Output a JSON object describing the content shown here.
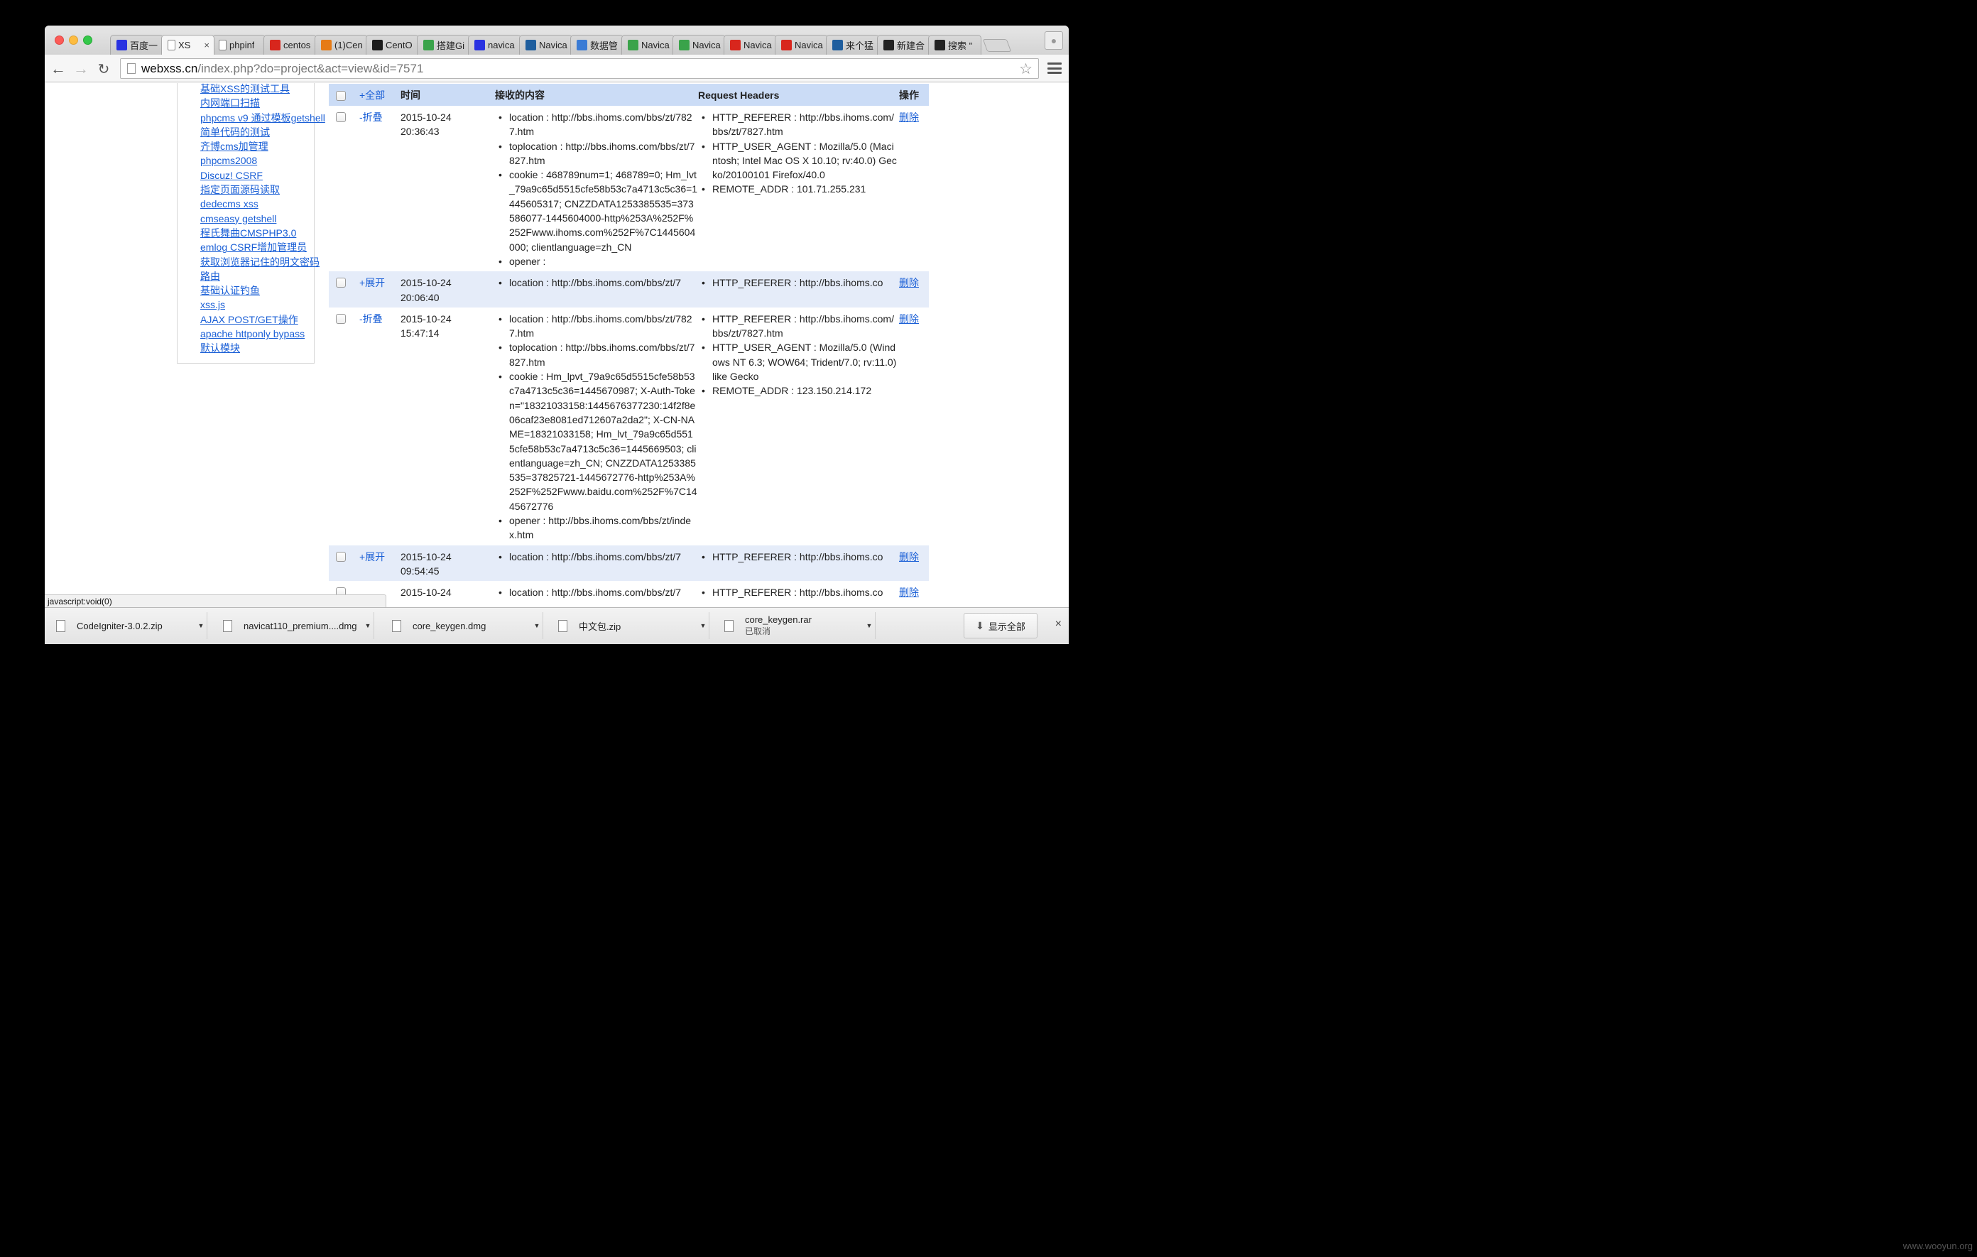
{
  "tabs": [
    {
      "label": "百度一",
      "icon": "baidu-paw-icon",
      "color": "#2932e1",
      "active": false
    },
    {
      "label": "XS",
      "icon": "blank-page-icon",
      "color": "#ffffff",
      "active": true,
      "close": "×"
    },
    {
      "label": "phpinf",
      "icon": "blank-page-icon",
      "color": "#ffffff",
      "active": false
    },
    {
      "label": "centos",
      "icon": "c-red-icon",
      "color": "#d8261d",
      "active": false
    },
    {
      "label": "(1)Cen",
      "icon": "colorful-house-icon",
      "color": "#e67b16",
      "active": false
    },
    {
      "label": "CentO",
      "icon": "terminal-icon",
      "color": "#1b1b1b",
      "active": false
    },
    {
      "label": "搭建Gi",
      "icon": "c-green-icon",
      "color": "#3aa34a",
      "active": false
    },
    {
      "label": "navica",
      "icon": "baidu-paw-icon",
      "color": "#2932e1",
      "active": false
    },
    {
      "label": "Navica",
      "icon": "navicat-icon",
      "color": "#1f5e9e",
      "active": false
    },
    {
      "label": "数据管",
      "icon": "cloud-icon",
      "color": "#3a7bd5",
      "active": false
    },
    {
      "label": "Navica",
      "icon": "c-green-icon",
      "color": "#3aa34a",
      "active": false
    },
    {
      "label": "Navica",
      "icon": "c-green-icon",
      "color": "#3aa34a",
      "active": false
    },
    {
      "label": "Navica",
      "icon": "c-red-icon",
      "color": "#d8261d",
      "active": false
    },
    {
      "label": "Navica",
      "icon": "c-red-icon",
      "color": "#d8261d",
      "active": false
    },
    {
      "label": "来个猛",
      "icon": "navicat-icon",
      "color": "#1f5e9e",
      "active": false
    },
    {
      "label": "新建合",
      "icon": "git-icon",
      "color": "#222222",
      "active": false
    },
    {
      "label": "搜索 \"",
      "icon": "git-icon",
      "color": "#222222",
      "active": false
    }
  ],
  "toolbar": {
    "url_host": "webxss.cn",
    "url_path": "/index.php?do=project&act=view&id=7571"
  },
  "sidebar": {
    "links": [
      "基础XSS的测试工具",
      "内网端口扫描",
      "phpcms v9 通过模板getshell",
      "简单代码的测试",
      "齐博cms加管理",
      "phpcms2008",
      "Discuz! CSRF",
      "指定页面源码读取",
      "dedecms xss",
      "cmseasy getshell",
      "程氏舞曲CMSPHP3.0",
      "emlog CSRF增加管理员",
      "获取浏览器记住的明文密码",
      "路由",
      "基础认证钓鱼",
      "xss.js",
      "AJAX POST/GET操作",
      "apache httponly bypass",
      "默认模块"
    ]
  },
  "table": {
    "headers": {
      "toggle_all": "+全部",
      "time": "时间",
      "content": "接收的内容",
      "request_headers": "Request Headers",
      "op": "操作"
    },
    "rows": [
      {
        "toggle": "-折叠",
        "date": "2015-10-24",
        "time": "20:36:43",
        "content": [
          "location : http://bbs.ihoms.com/bbs/zt/7827.htm",
          "toplocation : http://bbs.ihoms.com/bbs/zt/7827.htm",
          "cookie : 468789num=1; 468789=0; Hm_lvt_79a9c65d5515cfe58b53c7a4713c5c36=1445605317; CNZZDATA1253385535=373586077-1445604000-http%253A%252F%252Fwww.ihoms.com%252F%7C1445604000; clientlanguage=zh_CN",
          "opener :"
        ],
        "headers": [
          "HTTP_REFERER : http://bbs.ihoms.com/bbs/zt/7827.htm",
          "HTTP_USER_AGENT : Mozilla/5.0 (Macintosh; Intel Mac OS X 10.10; rv:40.0) Gecko/20100101 Firefox/40.0",
          "REMOTE_ADDR : 101.71.255.231"
        ],
        "op": "删除"
      },
      {
        "toggle": "+展开",
        "date": "2015-10-24",
        "time": "20:06:40",
        "content": [
          "location : http://bbs.ihoms.com/bbs/zt/7"
        ],
        "headers": [
          "HTTP_REFERER : http://bbs.ihoms.co"
        ],
        "op": "删除"
      },
      {
        "toggle": "-折叠",
        "date": "2015-10-24",
        "time": "15:47:14",
        "content": [
          "location : http://bbs.ihoms.com/bbs/zt/7827.htm",
          "toplocation : http://bbs.ihoms.com/bbs/zt/7827.htm",
          "cookie : Hm_lpvt_79a9c65d5515cfe58b53c7a4713c5c36=1445670987; X-Auth-Token=\"18321033158:1445676377230:14f2f8e06caf23e8081ed712607a2da2\"; X-CN-NAME=18321033158; Hm_lvt_79a9c65d5515cfe58b53c7a4713c5c36=1445669503; clientlanguage=zh_CN; CNZZDATA1253385535=37825721-1445672776-http%253A%252F%252Fwww.baidu.com%252F%7C1445672776",
          "opener : http://bbs.ihoms.com/bbs/zt/index.htm"
        ],
        "headers": [
          "HTTP_REFERER : http://bbs.ihoms.com/bbs/zt/7827.htm",
          "HTTP_USER_AGENT : Mozilla/5.0 (Windows NT 6.3; WOW64; Trident/7.0; rv:11.0) like Gecko",
          "REMOTE_ADDR : 123.150.214.172"
        ],
        "op": "删除"
      },
      {
        "toggle": "+展开",
        "date": "2015-10-24",
        "time": "09:54:45",
        "content": [
          "location : http://bbs.ihoms.com/bbs/zt/7"
        ],
        "headers": [
          "HTTP_REFERER : http://bbs.ihoms.co"
        ],
        "op": "删除"
      },
      {
        "toggle": "",
        "date": "2015-10-24",
        "time": "",
        "content": [
          "location : http://bbs.ihoms.com/bbs/zt/7"
        ],
        "headers": [
          "HTTP_REFERER : http://bbs.ihoms.co"
        ],
        "op": "删除"
      }
    ]
  },
  "status_bubble": "javascript:void(0)",
  "downloads": {
    "items": [
      {
        "name": "CodeIgniter-3.0.2.zip",
        "sub": ""
      },
      {
        "name": "navicat110_premium....dmg",
        "sub": ""
      },
      {
        "name": "core_keygen.dmg",
        "sub": ""
      },
      {
        "name": "中文包.zip",
        "sub": ""
      },
      {
        "name": "core_keygen.rar",
        "sub": "已取消"
      }
    ],
    "show_all": "显示全部",
    "close": "×"
  },
  "watermark": "www.wooyun.org"
}
